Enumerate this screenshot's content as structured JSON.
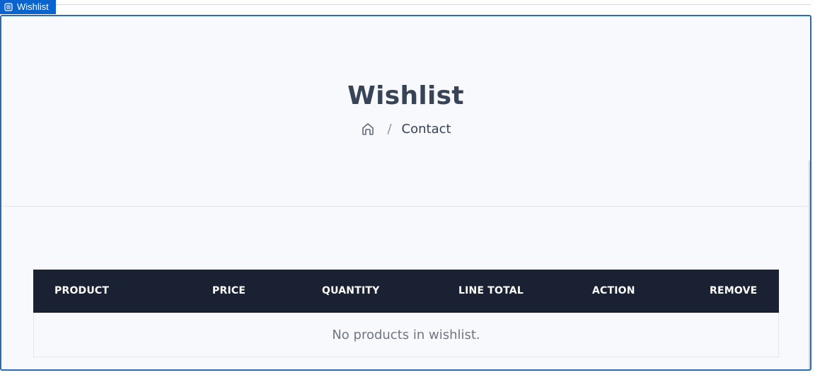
{
  "tab": {
    "label": "Wishlist",
    "icon": "list-icon"
  },
  "hero": {
    "title": "Wishlist",
    "breadcrumb": {
      "home_icon": "home-icon",
      "separator": "/",
      "current": "Contact"
    }
  },
  "table": {
    "columns": [
      "PRODUCT",
      "PRICE",
      "QUANTITY",
      "LINE TOTAL",
      "ACTION",
      "REMOVE"
    ],
    "empty_message": "No products in wishlist."
  },
  "colors": {
    "accent": "#0b63ce",
    "header_bg": "#192133",
    "text_dark": "#374357",
    "page_bg": "#f7f9fc"
  }
}
